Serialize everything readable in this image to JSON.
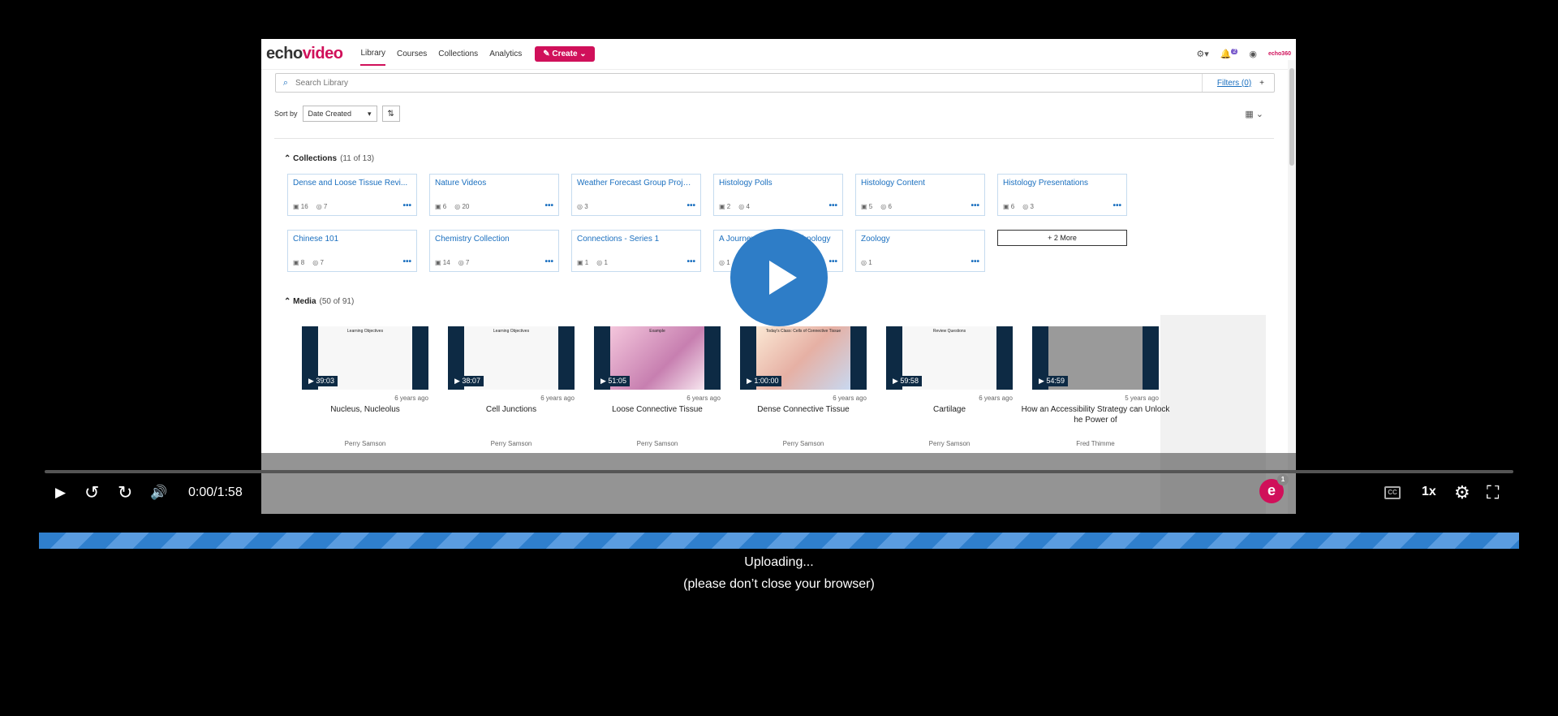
{
  "app": {
    "logo_prefix": "echo",
    "logo_suffix": "video",
    "brand_small": "echo360"
  },
  "nav": {
    "tabs": [
      "Library",
      "Courses",
      "Collections",
      "Analytics"
    ],
    "create_label": "Create",
    "notif_count": "2"
  },
  "search": {
    "placeholder": "Search Library",
    "filters_label": "Filters (0)"
  },
  "sort": {
    "label": "Sort by",
    "value": "Date Created"
  },
  "collections": {
    "title": "Collections",
    "count": "(11 of 13)",
    "items": [
      {
        "name": "Dense and Loose Tissue Revi...",
        "media": "16",
        "users": "7"
      },
      {
        "name": "Nature Videos",
        "media": "6",
        "users": "20"
      },
      {
        "name": "Weather Forecast Group Proje...",
        "media": "",
        "users": "3"
      },
      {
        "name": "Histology Polls",
        "media": "2",
        "users": "4"
      },
      {
        "name": "Histology Content",
        "media": "5",
        "users": "6"
      },
      {
        "name": "Histology Presentations",
        "media": "6",
        "users": "3"
      },
      {
        "name": "Chinese 101",
        "media": "8",
        "users": "7"
      },
      {
        "name": "Chemistry Collection",
        "media": "14",
        "users": "7"
      },
      {
        "name": "Connections - Series 1",
        "media": "1",
        "users": "1"
      },
      {
        "name": "A Journey Through Technology",
        "media": "",
        "users": "1"
      },
      {
        "name": "Zoology",
        "media": "",
        "users": "1"
      }
    ],
    "more_label": "+ 2 More"
  },
  "media": {
    "title": "Media",
    "count": "(50 of 91)",
    "items": [
      {
        "duration": "39:03",
        "age": "6 years ago",
        "title": "Nucleus, Nucleolus",
        "author": "Perry Samson",
        "slide": "Learning Objectives"
      },
      {
        "duration": "38:07",
        "age": "6 years ago",
        "title": "Cell Junctions",
        "author": "Perry Samson",
        "slide": "Learning Objectives"
      },
      {
        "duration": "51:05",
        "age": "6 years ago",
        "title": "Loose Connective Tissue",
        "author": "Perry Samson",
        "slide": "Example"
      },
      {
        "duration": "1:00:00",
        "age": "6 years ago",
        "title": "Dense Connective Tissue",
        "author": "Perry Samson",
        "slide": "Today's Class: Cells of Connective Tissue"
      },
      {
        "duration": "59:58",
        "age": "6 years ago",
        "title": "Cartilage",
        "author": "Perry Samson",
        "slide": "Review Questions"
      },
      {
        "duration": "54:59",
        "age": "5 years ago",
        "title": "How an Accessibility Strategy can Unlock he Power of",
        "author": "Fred Thimme",
        "slide": ""
      }
    ]
  },
  "player": {
    "time": "0:00/1:58",
    "cc": "CC",
    "speed": "1x",
    "badge": "e",
    "badge_count": "1",
    "progress_fraction": 0
  },
  "upload": {
    "status": "Uploading...",
    "note": "(please don’t close your browser)"
  },
  "colors": {
    "accent": "#d0105a",
    "link": "#1a6fbf",
    "play": "#2e7dc7",
    "upload": "#2f7fcd"
  }
}
